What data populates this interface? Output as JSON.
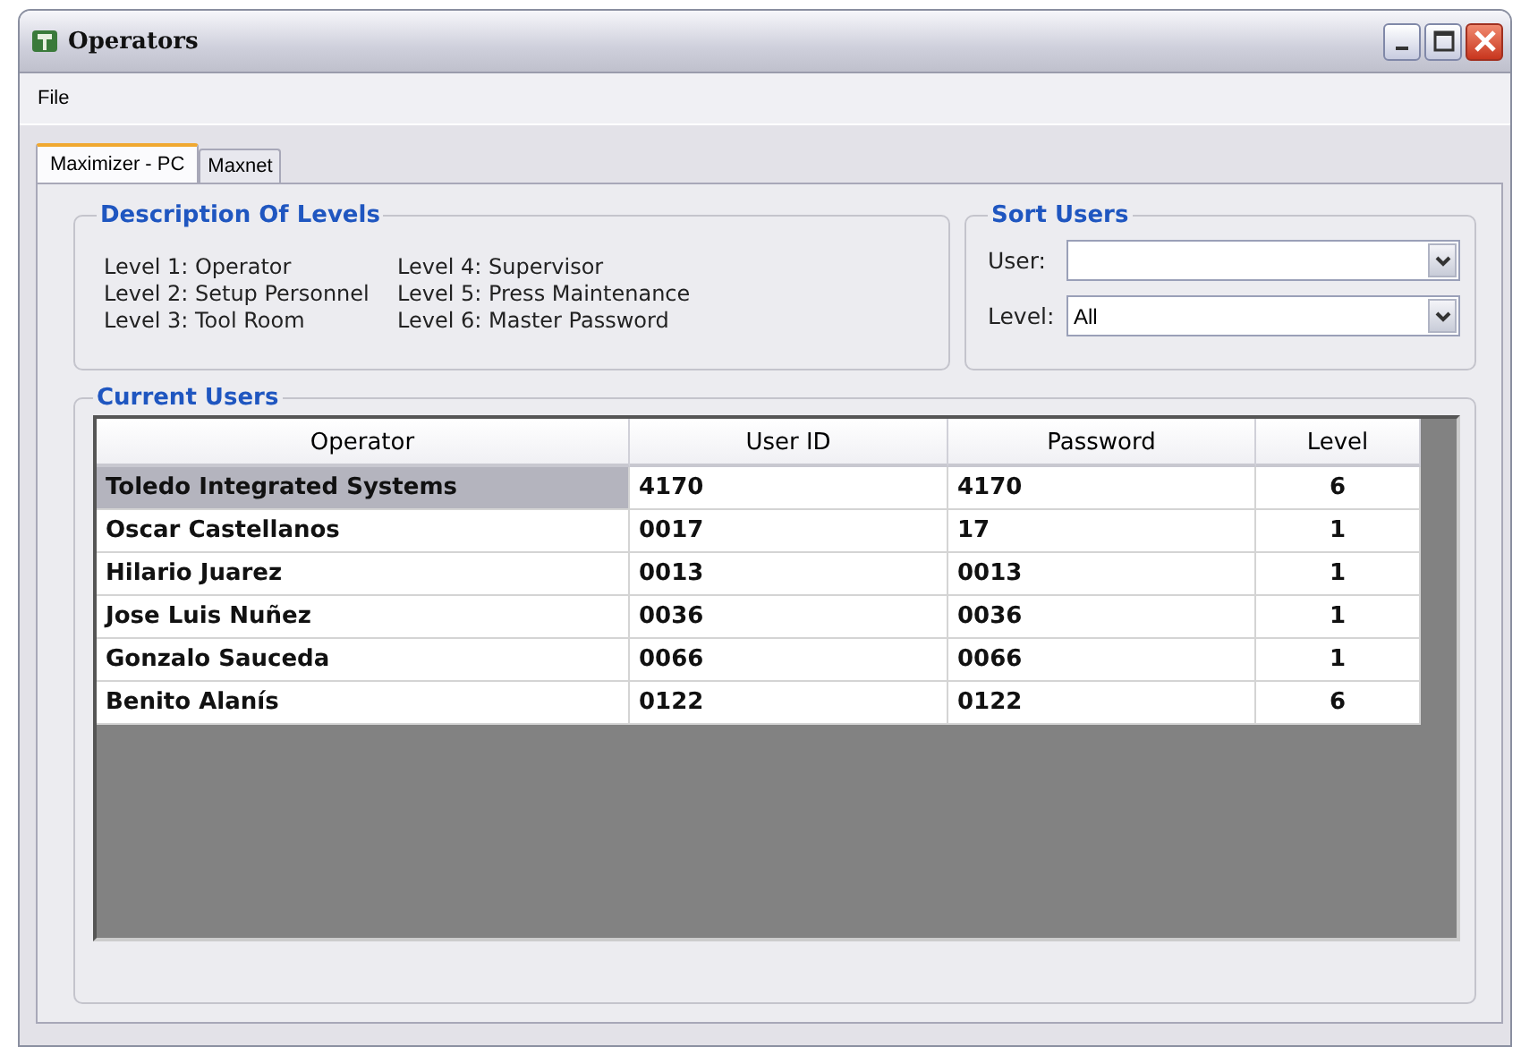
{
  "window": {
    "title": "Operators"
  },
  "menu": [
    "File"
  ],
  "tabs": [
    {
      "label": "Maximizer - PC",
      "selected": true
    },
    {
      "label": "Maxnet",
      "selected": false
    }
  ],
  "levels_group": {
    "title": "Description Of Levels",
    "levels": [
      "Level 1: Operator",
      "Level 2: Setup Personnel",
      "Level 3: Tool Room",
      "Level 4: Supervisor",
      "Level 5: Press Maintenance",
      "Level 6: Master Password"
    ]
  },
  "sort_group": {
    "title": "Sort Users",
    "user": {
      "label": "User:"
    },
    "level": {
      "label": "Level:",
      "value": "All"
    }
  },
  "users_group": {
    "title": "Current Users"
  },
  "table": {
    "columns": [
      "Operator",
      "User ID",
      "Password",
      "Level"
    ],
    "rows": [
      {
        "cells": [
          "Toledo Integrated Systems",
          "4170",
          "4170",
          "6"
        ],
        "selected": true
      },
      {
        "cells": [
          "Oscar Castellanos",
          "0017",
          "17",
          "1"
        ],
        "selected": false
      },
      {
        "cells": [
          "Hilario Juarez",
          "0013",
          "0013",
          "1"
        ],
        "selected": false
      },
      {
        "cells": [
          "Jose Luis Nuñez",
          "0036",
          "0036",
          "1"
        ],
        "selected": false
      },
      {
        "cells": [
          "Gonzalo Sauceda",
          "0066",
          "0066",
          "1"
        ],
        "selected": false
      },
      {
        "cells": [
          "Benito Alanís",
          "0122",
          "0122",
          "6"
        ],
        "selected": false
      }
    ]
  }
}
